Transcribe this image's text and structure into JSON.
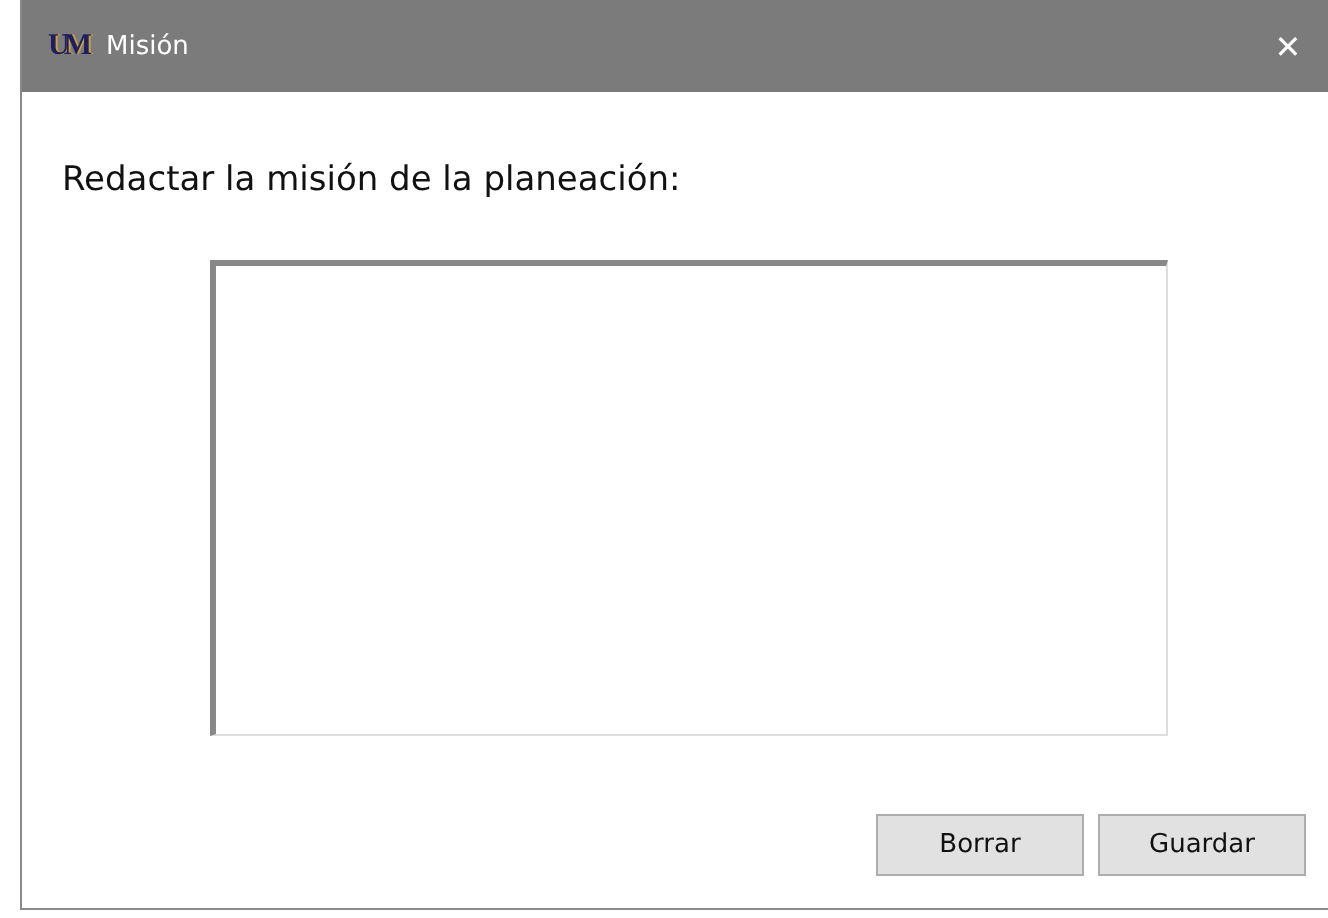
{
  "window": {
    "logo": "UM",
    "title": "Misión",
    "close": "✕"
  },
  "prompt": "Redactar la misión de la planeación:",
  "buttons": [
    "Borrar",
    "Guardar"
  ]
}
